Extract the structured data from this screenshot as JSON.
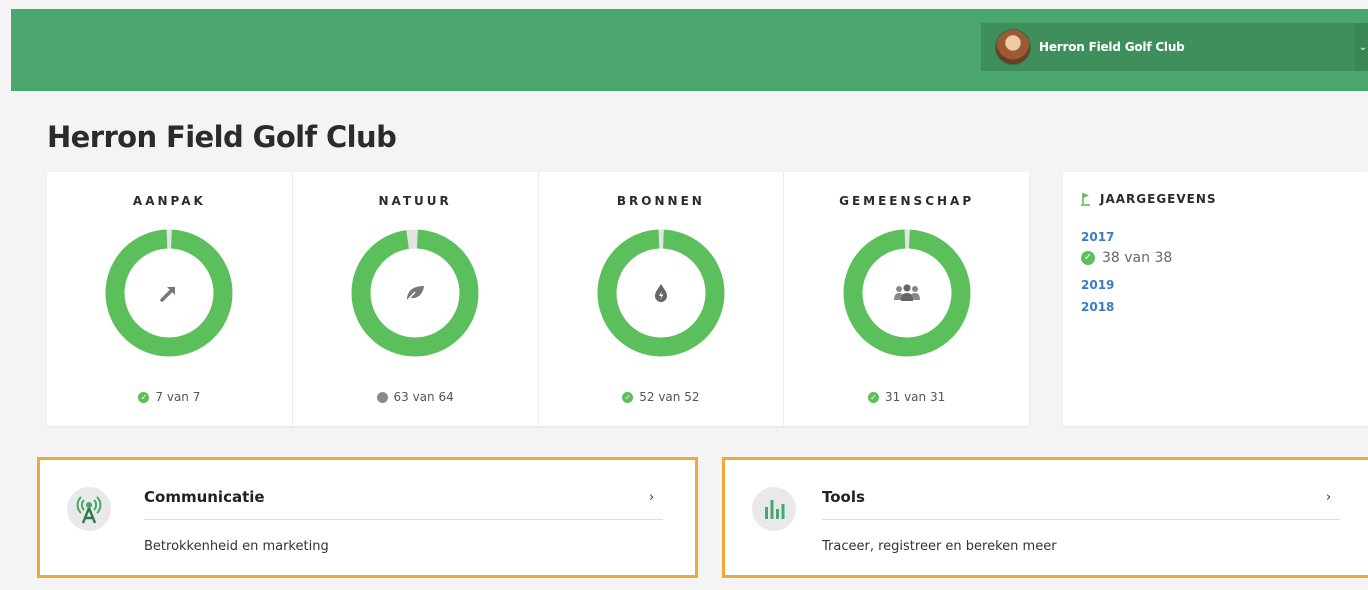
{
  "header": {
    "user_name": "Herron Field Golf Club",
    "chevron": "⌄",
    "brand_color": "#4aa66d"
  },
  "page": {
    "title": "Herron Field Golf Club"
  },
  "stats": [
    {
      "title": "AANPAK",
      "icon": "arrow-up-right-icon",
      "count": "7 van 7",
      "done": 7,
      "total": 7,
      "status": "complete"
    },
    {
      "title": "NATUUR",
      "icon": "leaf-icon",
      "count": "63 van 64",
      "done": 63,
      "total": 64,
      "status": "incomplete"
    },
    {
      "title": "BRONNEN",
      "icon": "water-drop-icon",
      "count": "52 van 52",
      "done": 52,
      "total": 52,
      "status": "complete"
    },
    {
      "title": "GEMEENSCHAP",
      "icon": "people-icon",
      "count": "31 van 31",
      "done": 31,
      "total": 31,
      "status": "complete"
    }
  ],
  "colors": {
    "ring_fill": "#5bbf5b",
    "ring_track": "#e3e3e3",
    "highlight": "#f0a83a",
    "link": "#3a7bc8"
  },
  "yearly": {
    "heading": "JAARGEGEVENS",
    "years": [
      "2017",
      "2019",
      "2018"
    ],
    "status": "38 van 38"
  },
  "cards": [
    {
      "title": "Communicatie",
      "subtitle": "Betrokkenheid en marketing",
      "icon": "broadcast-antenna-icon",
      "chevron": "›"
    },
    {
      "title": "Tools",
      "subtitle": "Traceer, registreer en bereken meer",
      "icon": "bar-chart-icon",
      "chevron": "›"
    }
  ]
}
